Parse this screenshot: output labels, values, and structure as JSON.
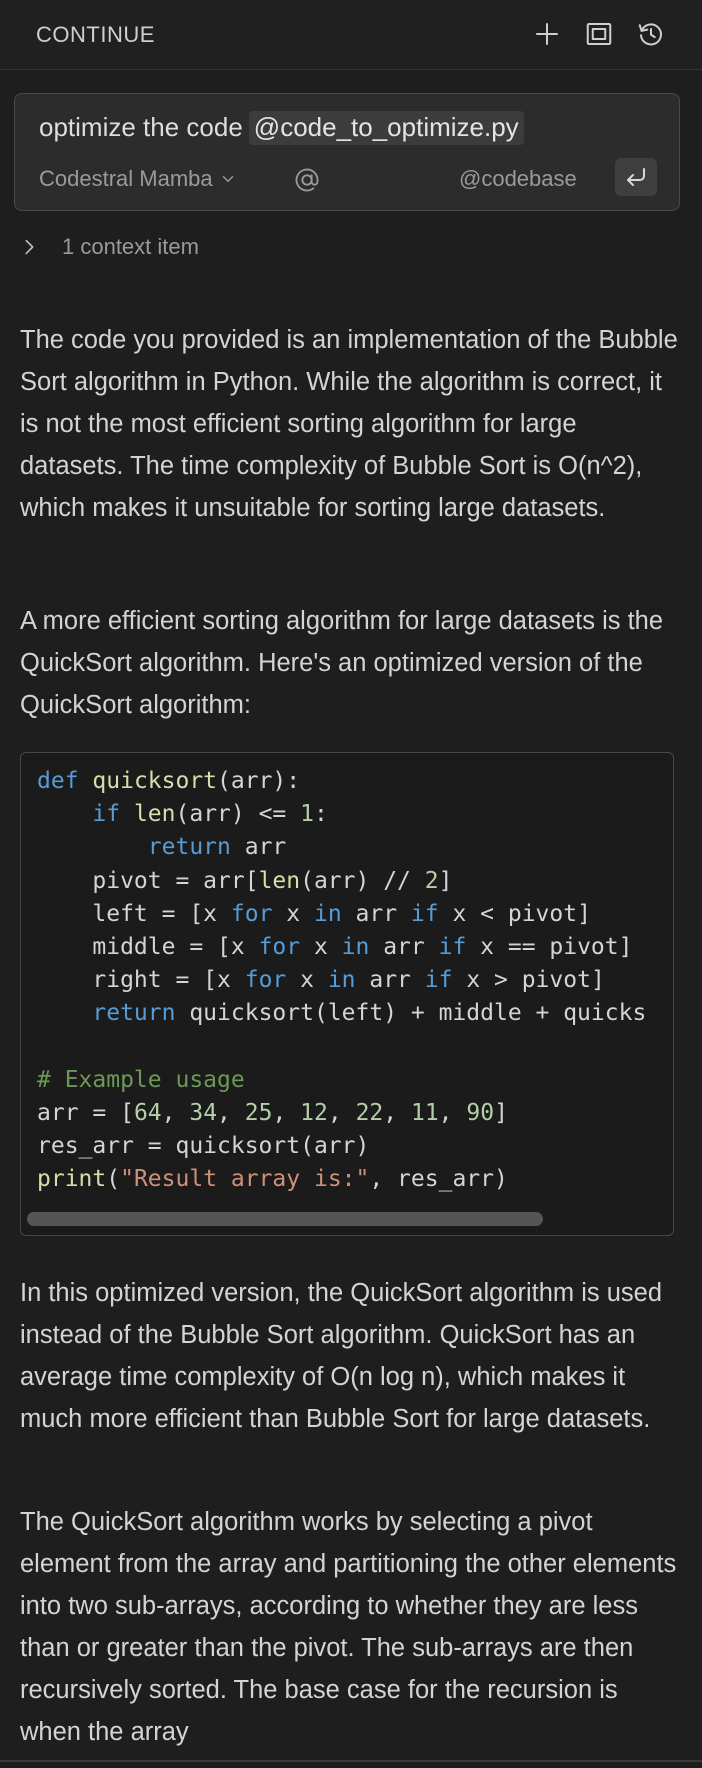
{
  "header": {
    "title": "CONTINUE",
    "icons": [
      "plus-icon",
      "fullscreen-icon",
      "history-icon"
    ]
  },
  "input": {
    "query_text": "optimize the code",
    "mention": "@code_to_optimize.py",
    "model": "Codestral Mamba",
    "codebase_label": "@codebase"
  },
  "context": {
    "label": "1 context item"
  },
  "response": {
    "p1": "The code you provided is an implementation of the Bubble Sort algorithm in Python. While the algorithm is correct, it is not the most efficient sorting algorithm for large datasets. The time complexity of Bubble Sort is O(n^2), which makes it unsuitable for sorting large datasets.",
    "p2": "A more efficient sorting algorithm for large datasets is the QuickSort algorithm. Here's an optimized version of the QuickSort algorithm:",
    "code": {
      "language": "python",
      "lines": [
        "def quicksort(arr):",
        "    if len(arr) <= 1:",
        "        return arr",
        "    pivot = arr[len(arr) // 2]",
        "    left = [x for x in arr if x < pivot]",
        "    middle = [x for x in arr if x == pivot]",
        "    right = [x for x in arr if x > pivot]",
        "    return quicksort(left) + middle + quicks",
        "",
        "# Example usage",
        "arr = [64, 34, 25, 12, 22, 11, 90]",
        "res_arr = quicksort(arr)",
        "print(\"Result array is:\", res_arr)"
      ]
    },
    "p3": "In this optimized version, the QuickSort algorithm is used instead of the Bubble Sort algorithm. QuickSort has an average time complexity of O(n log n), which makes it much more efficient than Bubble Sort for large datasets.",
    "p4": "The QuickSort algorithm works by selecting a pivot element from the array and partitioning the other elements into two sub-arrays, according to whether they are less than or greater than the pivot. The sub-arrays are then recursively sorted. The base case for the recursion is when the array"
  },
  "colors": {
    "background": "#1e1e1e",
    "keyword": "#569cd6",
    "function": "#dcdcaa",
    "number": "#b5cea8",
    "string": "#ce9178",
    "comment": "#6a9955"
  }
}
